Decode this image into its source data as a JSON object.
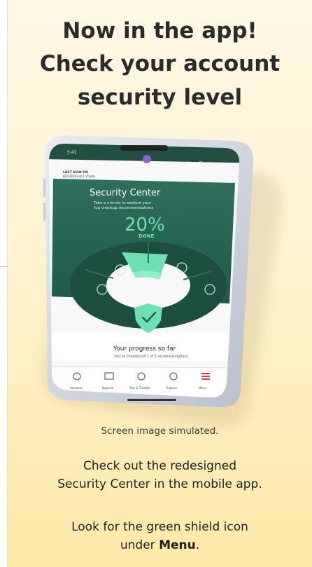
{
  "headline": {
    "line1": "Now in the app!",
    "line2": "Check your account",
    "line3": "security level"
  },
  "phone_screen": {
    "time": "5:41",
    "sign_off": "Sign off",
    "last_sign_on_label": "LAST SIGN ON",
    "last_sign_on_value": "8/22/2023 at 1:25 pm",
    "security_center_title": "Security Center",
    "tagline_line1": "Take a minute to explore your",
    "tagline_line2": "top checkup recommendations",
    "progress_percent": "20%",
    "progress_done": "DONE",
    "progress_fraction": 0.2,
    "progress_heading": "Your progress so far",
    "progress_sub": "You've checked off 1 of 5 recommendations",
    "nav": [
      {
        "label": "Accounts",
        "icon": "home-icon"
      },
      {
        "label": "Deposit",
        "icon": "deposit-icon"
      },
      {
        "label": "Pay & Transfer",
        "icon": "transfer-icon"
      },
      {
        "label": "Explore",
        "icon": "explore-icon"
      },
      {
        "label": "Menu",
        "icon": "menu-icon"
      }
    ],
    "colors": {
      "panel_dark": "#1e5a4a",
      "panel_mid": "#2f6f5c",
      "accent_green": "#6fe0b3",
      "menu_red": "#d71e28"
    }
  },
  "caption": "Screen image simulated.",
  "body": {
    "line1": "Check out the redesigned",
    "line2": "Security Center in the mobile app.",
    "line3": "Look for the green shield icon",
    "line4_prefix": "under ",
    "line4_bold": "Menu",
    "line4_suffix": "."
  }
}
